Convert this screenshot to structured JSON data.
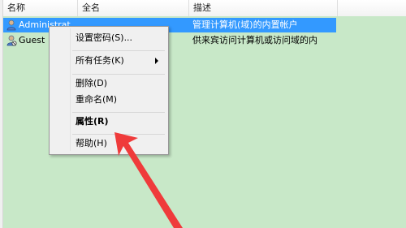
{
  "columns": {
    "name": "名称",
    "fullname": "全名",
    "description": "描述"
  },
  "users": [
    {
      "name": "Administrat",
      "description": "管理计算机(域)的内置帐户",
      "icon": "user-icon"
    },
    {
      "name": "Guest",
      "description": "供来宾访问计算机或访问域的内",
      "icon": "user-icon"
    }
  ],
  "context_menu": {
    "set_password": "设置密码(S)...",
    "all_tasks": "所有任务(K)",
    "delete": "删除(D)",
    "rename": "重命名(M)",
    "properties": "属性(R)",
    "help": "帮助(H)"
  },
  "colors": {
    "selection": "#3399ff",
    "background": "#c8e8c8",
    "arrow": "#ef3b3b"
  }
}
